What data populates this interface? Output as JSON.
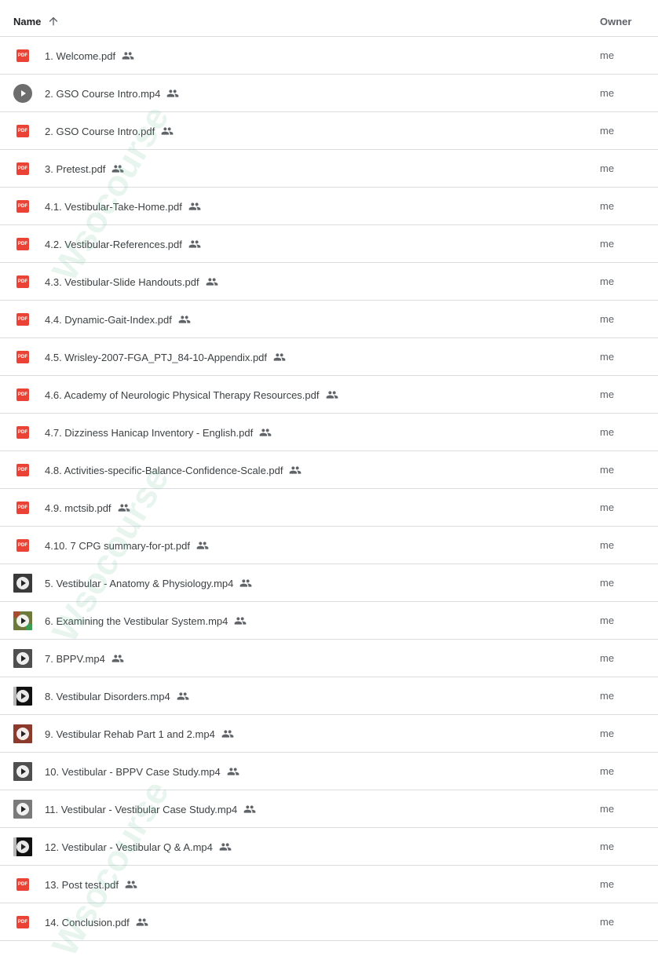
{
  "header": {
    "name_label": "Name",
    "owner_label": "Owner"
  },
  "watermark": "Wsocourse",
  "files": [
    {
      "name": "1. Welcome.pdf",
      "type": "pdf",
      "owner": "me"
    },
    {
      "name": "2. GSO Course Intro.mp4",
      "type": "video-circle",
      "owner": "me"
    },
    {
      "name": "2. GSO Course Intro.pdf",
      "type": "pdf",
      "owner": "me"
    },
    {
      "name": "3. Pretest.pdf",
      "type": "pdf",
      "owner": "me"
    },
    {
      "name": "4.1. Vestibular-Take-Home.pdf",
      "type": "pdf",
      "owner": "me"
    },
    {
      "name": "4.2. Vestibular-References.pdf",
      "type": "pdf",
      "owner": "me"
    },
    {
      "name": "4.3. Vestibular-Slide Handouts.pdf",
      "type": "pdf",
      "owner": "me"
    },
    {
      "name": "4.4. Dynamic-Gait-Index.pdf",
      "type": "pdf",
      "owner": "me"
    },
    {
      "name": "4.5. Wrisley-2007-FGA_PTJ_84-10-Appendix.pdf",
      "type": "pdf",
      "owner": "me"
    },
    {
      "name": "4.6. Academy of Neurologic Physical Therapy Resources.pdf",
      "type": "pdf",
      "owner": "me"
    },
    {
      "name": "4.7. Dizziness Hanicap Inventory - English.pdf",
      "type": "pdf",
      "owner": "me"
    },
    {
      "name": "4.8. Activities-specific-Balance-Confidence-Scale.pdf",
      "type": "pdf",
      "owner": "me"
    },
    {
      "name": "4.9. mctsib.pdf",
      "type": "pdf",
      "owner": "me"
    },
    {
      "name": "4.10. 7 CPG summary-for-pt.pdf",
      "type": "pdf",
      "owner": "me"
    },
    {
      "name": "5. Vestibular - Anatomy & Physiology.mp4",
      "type": "video-dark",
      "owner": "me"
    },
    {
      "name": "6. Examining the Vestibular System.mp4",
      "type": "video-colorful",
      "owner": "me"
    },
    {
      "name": "7. BPPV.mp4",
      "type": "video-gray",
      "owner": "me"
    },
    {
      "name": "8. Vestibular Disorders.mp4",
      "type": "video-black",
      "owner": "me"
    },
    {
      "name": "9. Vestibular Rehab Part 1 and 2.mp4",
      "type": "video-red",
      "owner": "me"
    },
    {
      "name": "10. Vestibular - BPPV Case Study.mp4",
      "type": "video-gray",
      "owner": "me"
    },
    {
      "name": "11. Vestibular - Vestibular Case Study.mp4",
      "type": "video-light",
      "owner": "me"
    },
    {
      "name": "12. Vestibular - Vestibular Q & A.mp4",
      "type": "video-black",
      "owner": "me"
    },
    {
      "name": "13. Post test.pdf",
      "type": "pdf",
      "owner": "me"
    },
    {
      "name": "14. Conclusion.pdf",
      "type": "pdf",
      "owner": "me"
    }
  ],
  "icons": {
    "pdf_label": "PDF",
    "sort": "arrow-up-icon",
    "shared": "people-icon"
  },
  "colors": {
    "pdf": "#ea4335",
    "divider": "#dadce0",
    "text": "#3c4043"
  }
}
